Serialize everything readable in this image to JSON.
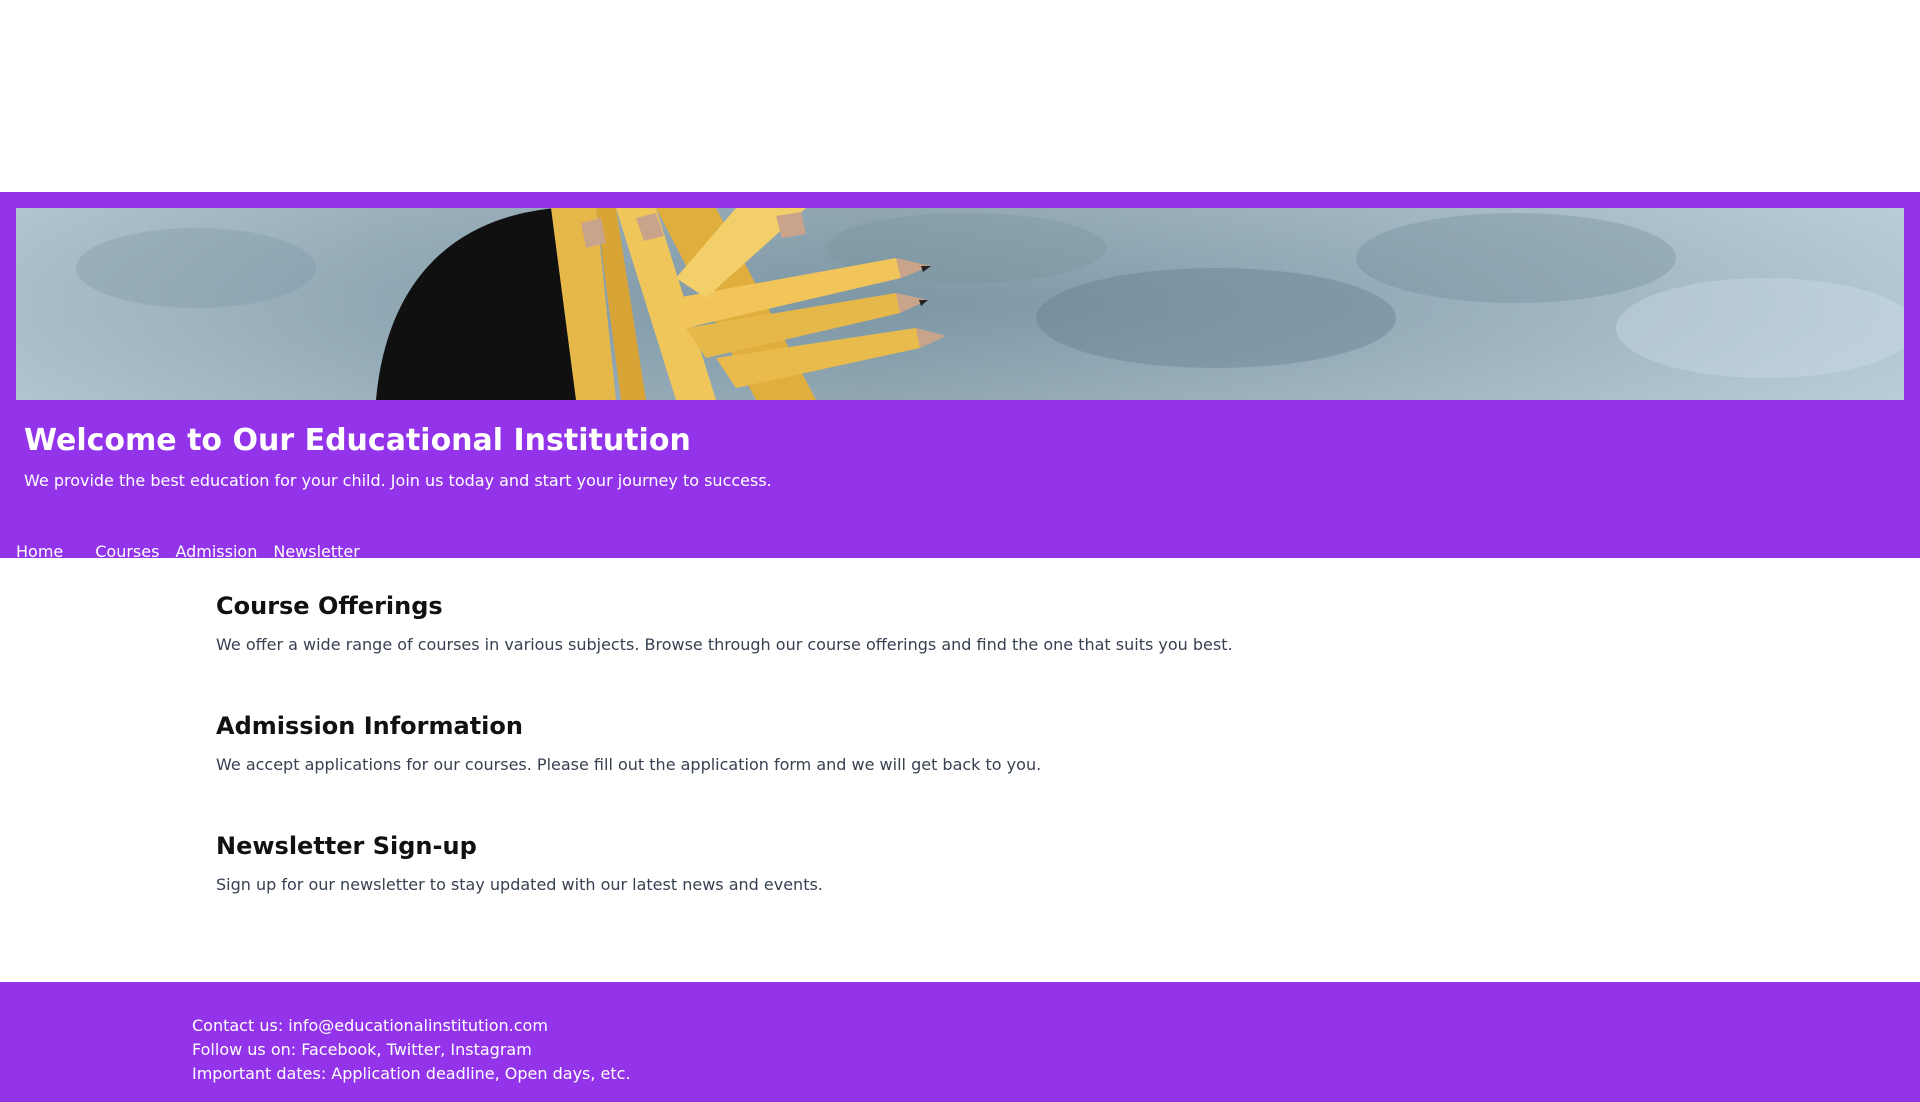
{
  "hero": {
    "title": "Welcome to Our Educational Institution",
    "subtitle": "We provide the best education for your child. Join us today and start your journey to success."
  },
  "nav": {
    "items": [
      {
        "label": "Home"
      },
      {
        "label": "Courses"
      },
      {
        "label": "Admission"
      },
      {
        "label": "Newsletter"
      }
    ]
  },
  "sections": [
    {
      "heading": "Course Offerings",
      "text": "We offer a wide range of courses in various subjects. Browse through our course offerings and find the one that suits you best."
    },
    {
      "heading": "Admission Information",
      "text": "We accept applications for our courses. Please fill out the application form and we will get back to you."
    },
    {
      "heading": "Newsletter Sign-up",
      "text": "Sign up for our newsletter to stay updated with our latest news and events."
    }
  ],
  "footer": {
    "contact": "Contact us: info@educationalinstitution.com",
    "follow": "Follow us on: Facebook, Twitter, Instagram",
    "dates": "Important dates: Application deadline, Open days, etc."
  },
  "colors": {
    "brand": "#9333ea",
    "heading_text": "#111111",
    "body_text": "#374151",
    "background": "#ffffff"
  },
  "icons": {
    "banner": "pencils-cup-image"
  }
}
